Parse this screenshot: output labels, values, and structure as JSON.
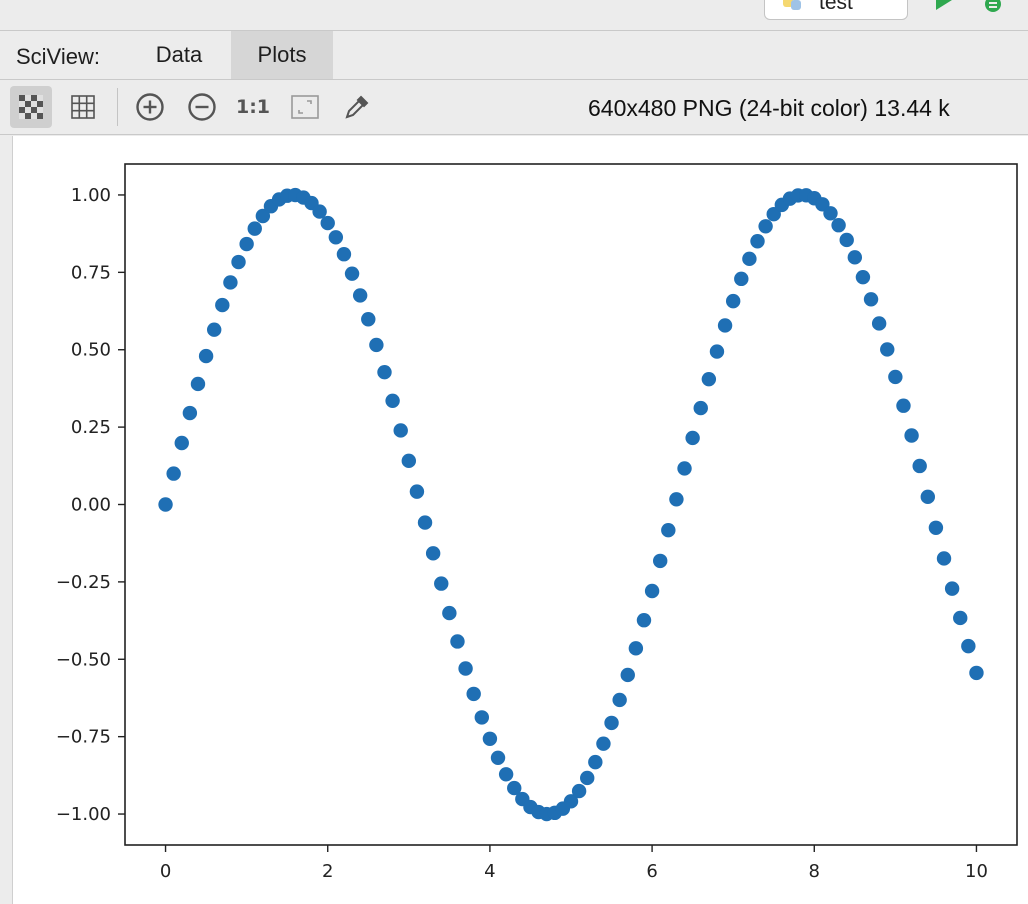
{
  "run_config": {
    "label": "test",
    "icon": "python-icon"
  },
  "toolbar_top": {
    "run_icon": "play-icon",
    "debug_icon": "bug-icon"
  },
  "sciview": {
    "label": "SciView:",
    "tabs": [
      {
        "label": "Data",
        "active": false
      },
      {
        "label": "Plots",
        "active": true
      }
    ]
  },
  "plot_toolbar": {
    "buttons": [
      {
        "name": "checkerboard-icon",
        "active": true
      },
      {
        "name": "grid-icon",
        "active": false
      },
      {
        "name": "zoom-in-icon",
        "active": false
      },
      {
        "name": "zoom-out-icon",
        "active": false
      },
      {
        "name": "actual-size-button",
        "label": "1:1"
      },
      {
        "name": "fit-to-window-icon",
        "active": false
      },
      {
        "name": "color-picker-icon",
        "active": false
      }
    ],
    "image_info": "640x480 PNG (24-bit color) 13.44 k"
  },
  "colors": {
    "marker": "#1f6fb4",
    "accent_run": "#2fa84f",
    "axis": "#222222"
  },
  "chart_data": {
    "type": "scatter",
    "function": "sin(x)",
    "x_start": 0,
    "x_end": 10,
    "x_step": 0.1,
    "xlim": [
      -0.5,
      10.5
    ],
    "ylim": [
      -1.1,
      1.1
    ],
    "xticks": [
      0,
      2,
      4,
      6,
      8,
      10
    ],
    "xtick_labels": [
      "0",
      "2",
      "4",
      "6",
      "8",
      "10"
    ],
    "yticks": [
      1.0,
      0.75,
      0.5,
      0.25,
      0.0,
      -0.25,
      -0.5,
      -0.75,
      -1.0
    ],
    "ytick_labels": [
      "1.00",
      "0.75",
      "0.50",
      "0.25",
      "0.00",
      "−0.25",
      "−0.50",
      "−0.75",
      "−1.00"
    ],
    "title": "",
    "xlabel": "",
    "ylabel": "",
    "grid": false
  }
}
